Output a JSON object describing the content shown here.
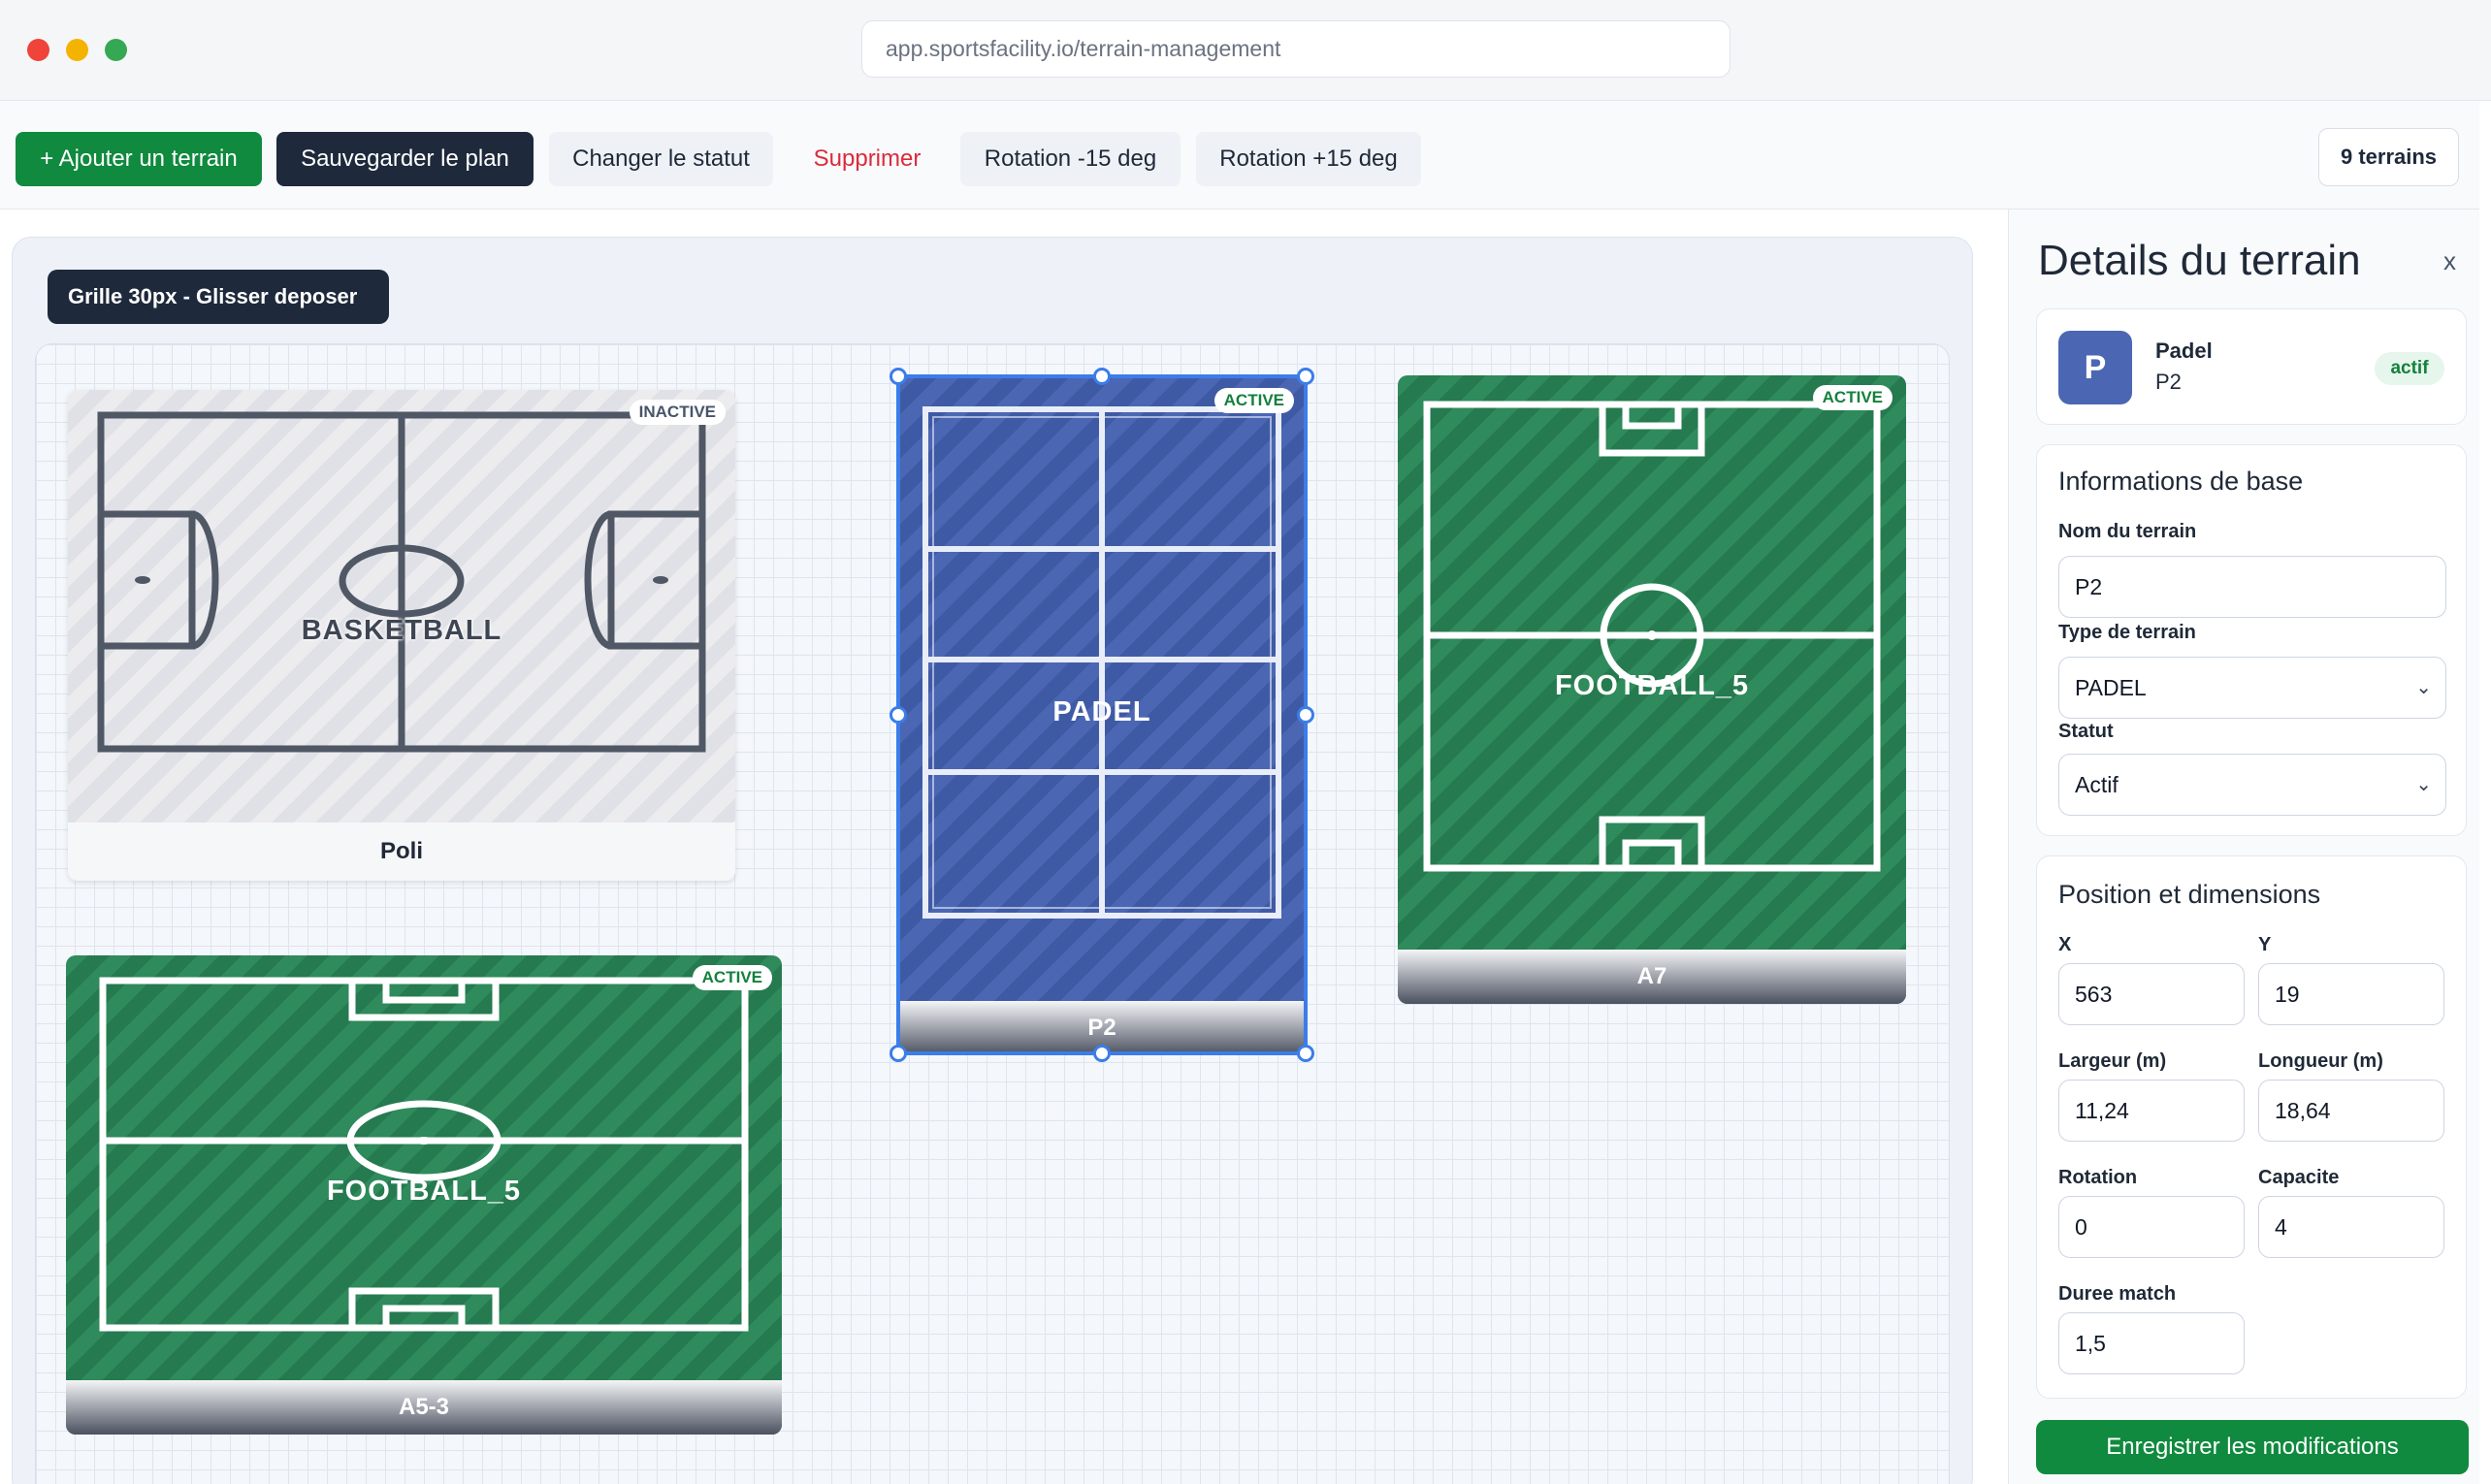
{
  "browser": {
    "url": "app.sportsfacility.io/terrain-management"
  },
  "toolbar": {
    "add_label": "+ Ajouter un terrain",
    "save_label": "Sauvegarder le plan",
    "status_label": "Changer le statut",
    "delete_label": "Supprimer",
    "rot_minus_label": "Rotation -15 deg",
    "rot_plus_label": "Rotation +15 deg",
    "count_label": "9 terrains"
  },
  "canvas": {
    "grid_badge": "Grille 30px - Glisser deposer",
    "courts": [
      {
        "name": "Poli",
        "type": "BASKETBALL",
        "status": "INACTIVE"
      },
      {
        "name": "P2",
        "type": "PADEL",
        "status": "ACTIVE",
        "selected": true
      },
      {
        "name": "A7",
        "type": "FOOTBALL_5",
        "status": "ACTIVE"
      },
      {
        "name": "A5-3",
        "type": "FOOTBALL_5",
        "status": "ACTIVE"
      }
    ]
  },
  "panel": {
    "title": "Details du terrain",
    "close": "x",
    "summary": {
      "initial": "P",
      "type": "Padel",
      "name": "P2",
      "status": "actif"
    },
    "basic": {
      "title": "Informations de base",
      "name_label": "Nom du terrain",
      "name_value": "P2",
      "type_label": "Type de terrain",
      "type_value": "PADEL",
      "status_label": "Statut",
      "status_value": "Actif"
    },
    "position": {
      "title": "Position et dimensions",
      "x_label": "X",
      "x_value": "563",
      "y_label": "Y",
      "y_value": "19",
      "width_label": "Largeur (m)",
      "width_value": "11,24",
      "length_label": "Longueur (m)",
      "length_value": "18,64",
      "rotation_label": "Rotation",
      "rotation_value": "0",
      "capacity_label": "Capacite",
      "capacity_value": "4",
      "duration_label": "Duree match",
      "duration_value": "1,5"
    },
    "save_label": "Enregistrer les modifications"
  },
  "colors": {
    "primary_green": "#0f8a3e",
    "dark": "#1e293b",
    "danger": "#dc2a3c",
    "selection": "#3b7de9",
    "padel": "#4b67b4",
    "football": "#2f8a5c"
  },
  "icons": {
    "close": "close-icon",
    "select": "chevron-down-icon"
  }
}
